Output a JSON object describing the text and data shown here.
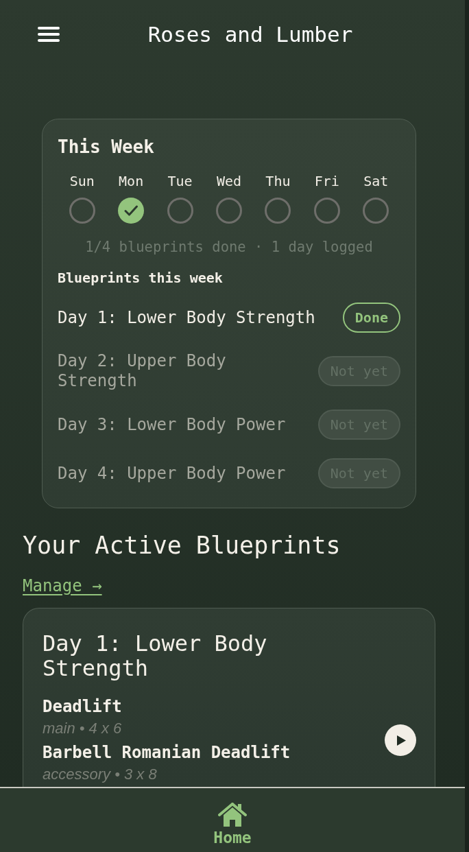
{
  "app_bar": {
    "title": "Roses and Lumber"
  },
  "week_card": {
    "title": "This Week",
    "days": [
      {
        "label": "Sun",
        "checked": false
      },
      {
        "label": "Mon",
        "checked": true
      },
      {
        "label": "Tue",
        "checked": false
      },
      {
        "label": "Wed",
        "checked": false
      },
      {
        "label": "Thu",
        "checked": false
      },
      {
        "label": "Fri",
        "checked": false
      },
      {
        "label": "Sat",
        "checked": false
      }
    ],
    "summary": "1/4 blueprints done · 1 day logged",
    "list_heading": "Blueprints this week",
    "blueprints": [
      {
        "name": "Day 1: Lower Body Strength",
        "done": true,
        "status": "Done"
      },
      {
        "name": "Day 2: Upper Body Strength",
        "done": false,
        "status": "Not yet"
      },
      {
        "name": "Day 3: Lower Body Power",
        "done": false,
        "status": "Not yet"
      },
      {
        "name": "Day 4: Upper Body Power",
        "done": false,
        "status": "Not yet"
      }
    ]
  },
  "active_blueprints": {
    "title": "Your Active Blueprints",
    "link": "Manage →",
    "cards": [
      {
        "title": "Day 1: Lower Body Strength",
        "exercises": [
          {
            "name": "Deadlift",
            "detail": "main • 4 x 6"
          },
          {
            "name": "Barbell Romanian Deadlift",
            "detail": "accessory • 3 x 8"
          }
        ]
      }
    ]
  },
  "bottom_nav": [
    {
      "label": "Home",
      "selected": true
    }
  ]
}
